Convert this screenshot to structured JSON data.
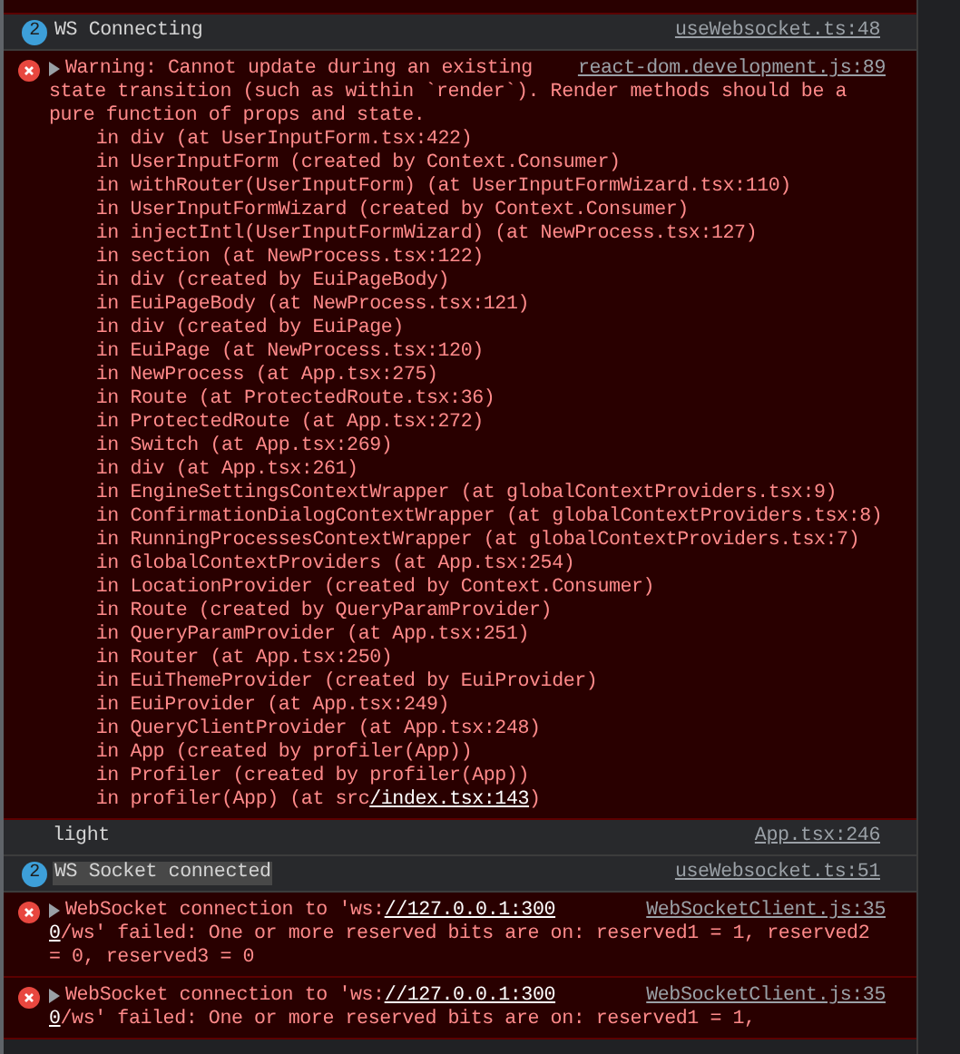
{
  "console": [
    {
      "kind": "group",
      "count": "2",
      "text": "WS Connecting",
      "source": "useWebsocket.ts:48",
      "highlighted": false
    },
    {
      "kind": "error",
      "text": "Warning: Cannot update during an existing",
      "continued": "state transition (such as within `render`). Render methods should be a pure function of props and state.",
      "source": "react-dom.development.js:89",
      "stack": [
        {
          "text": "in div (at UserInputForm.tsx:422)"
        },
        {
          "text": "in UserInputForm (created by Context.Consumer)"
        },
        {
          "text": "in withRouter(UserInputForm) (at UserInputFormWizard.tsx:110)"
        },
        {
          "text": "in UserInputFormWizard (created by Context.Consumer)"
        },
        {
          "text": "in injectIntl(UserInputFormWizard) (at NewProcess.tsx:127)"
        },
        {
          "text": "in section (at NewProcess.tsx:122)"
        },
        {
          "text": "in div (created by EuiPageBody)"
        },
        {
          "text": "in EuiPageBody (at NewProcess.tsx:121)"
        },
        {
          "text": "in div (created by EuiPage)"
        },
        {
          "text": "in EuiPage (at NewProcess.tsx:120)"
        },
        {
          "text": "in NewProcess (at App.tsx:275)"
        },
        {
          "text": "in Route (at ProtectedRoute.tsx:36)"
        },
        {
          "text": "in ProtectedRoute (at App.tsx:272)"
        },
        {
          "text": "in Switch (at App.tsx:269)"
        },
        {
          "text": "in div (at App.tsx:261)"
        },
        {
          "text": "in EngineSettingsContextWrapper (at globalContextProviders.tsx:9)"
        },
        {
          "text": "in ConfirmationDialogContextWrapper (at globalContextProviders.tsx:8)"
        },
        {
          "text": "in RunningProcessesContextWrapper (at globalContextProviders.tsx:7)"
        },
        {
          "text": "in GlobalContextProviders (at App.tsx:254)"
        },
        {
          "text": "in LocationProvider (created by Context.Consumer)"
        },
        {
          "text": "in Route (created by QueryParamProvider)"
        },
        {
          "text": "in QueryParamProvider (at App.tsx:251)"
        },
        {
          "text": "in Router (at App.tsx:250)"
        },
        {
          "text": "in EuiThemeProvider (created by EuiProvider)"
        },
        {
          "text": "in EuiProvider (at App.tsx:249)"
        },
        {
          "text": "in QueryClientProvider (at App.tsx:248)"
        },
        {
          "text": "in App (created by profiler(App))"
        },
        {
          "text": "in Profiler (created by profiler(App))"
        },
        {
          "text": "in profiler(App) (at src",
          "link": "/index.tsx:143",
          "after": ")"
        }
      ]
    },
    {
      "kind": "log",
      "text": "light",
      "source": "App.tsx:246"
    },
    {
      "kind": "group",
      "count": "2",
      "text": "WS Socket connected",
      "source": "useWebsocket.ts:51",
      "highlighted": true
    },
    {
      "kind": "error",
      "text": "WebSocket connection to 'ws:",
      "link": "//127.0.0.1:300",
      "continued_link": "0",
      "continued": "/ws' failed: One or more reserved bits are on: reserved1 = 1, reserved2 = 0, reserved3 = 0",
      "source": "WebSocketClient.js:35"
    },
    {
      "kind": "error",
      "text": "WebSocket connection to 'ws:",
      "link": "//127.0.0.1:300",
      "continued_link": "0",
      "continued": "/ws' failed: One or more reserved bits are on: reserved1 = 1,",
      "source": "WebSocketClient.js:35"
    }
  ]
}
